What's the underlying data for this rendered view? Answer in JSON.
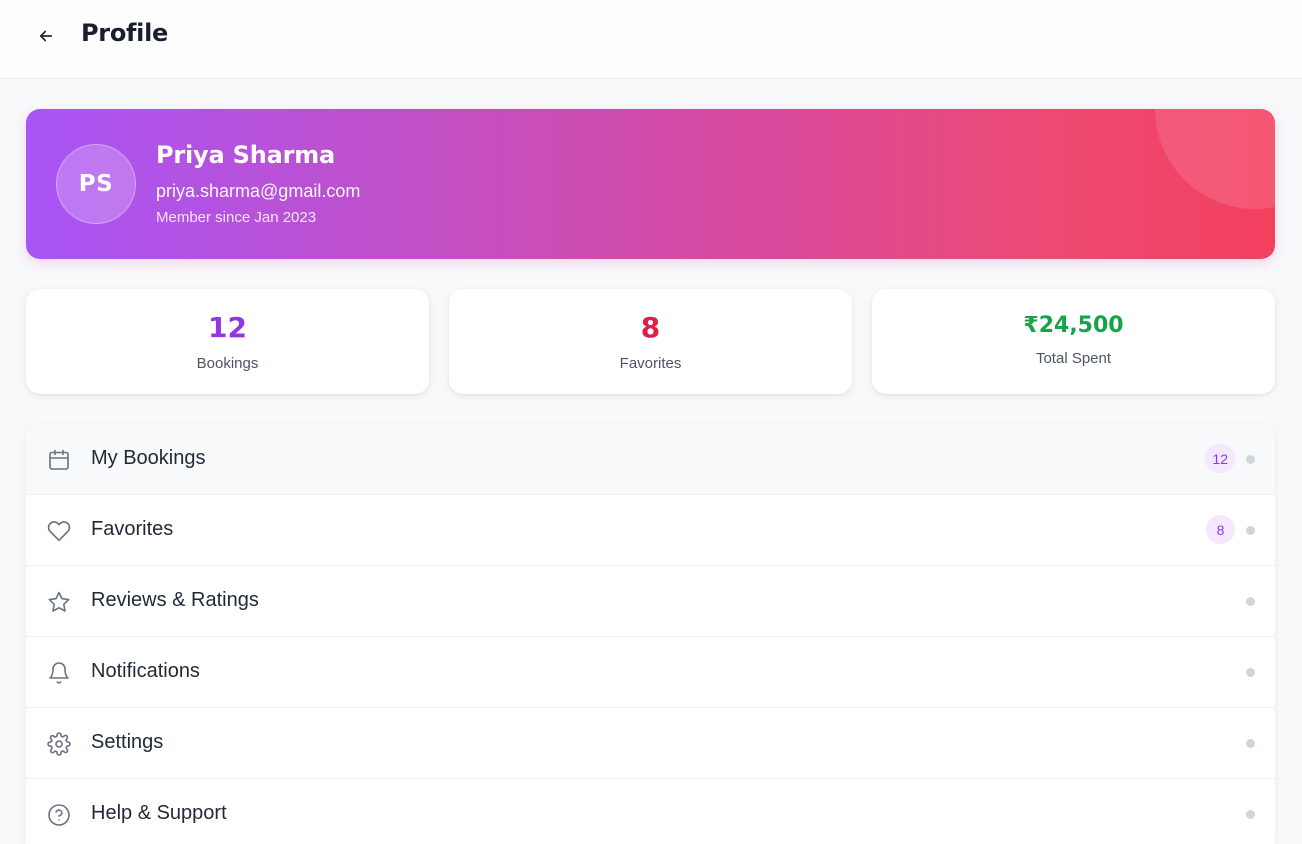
{
  "header": {
    "title": "Profile",
    "back_icon": "arrow-left-icon"
  },
  "profile": {
    "initials": "PS",
    "name": "Priya Sharma",
    "email": "priya.sharma@gmail.com",
    "member_since": "Member since Jan 2023",
    "gradient": [
      "#a855f7",
      "#f43f5e"
    ]
  },
  "stats": [
    {
      "value": "12",
      "label": "Bookings",
      "color": "#9333ea"
    },
    {
      "value": "8",
      "label": "Favorites",
      "color": "#e11d48"
    },
    {
      "value": "₹24,500",
      "label": "Total Spent",
      "color": "#16a34a"
    }
  ],
  "menu": {
    "items": [
      {
        "label": "My Bookings",
        "icon": "calendar-icon",
        "badge": "12"
      },
      {
        "label": "Favorites",
        "icon": "heart-icon",
        "badge": "8"
      },
      {
        "label": "Reviews & Ratings",
        "icon": "star-icon"
      },
      {
        "label": "Notifications",
        "icon": "bell-icon"
      },
      {
        "label": "Settings",
        "icon": "gear-icon"
      },
      {
        "label": "Help & Support",
        "icon": "help-circle-icon"
      }
    ]
  }
}
